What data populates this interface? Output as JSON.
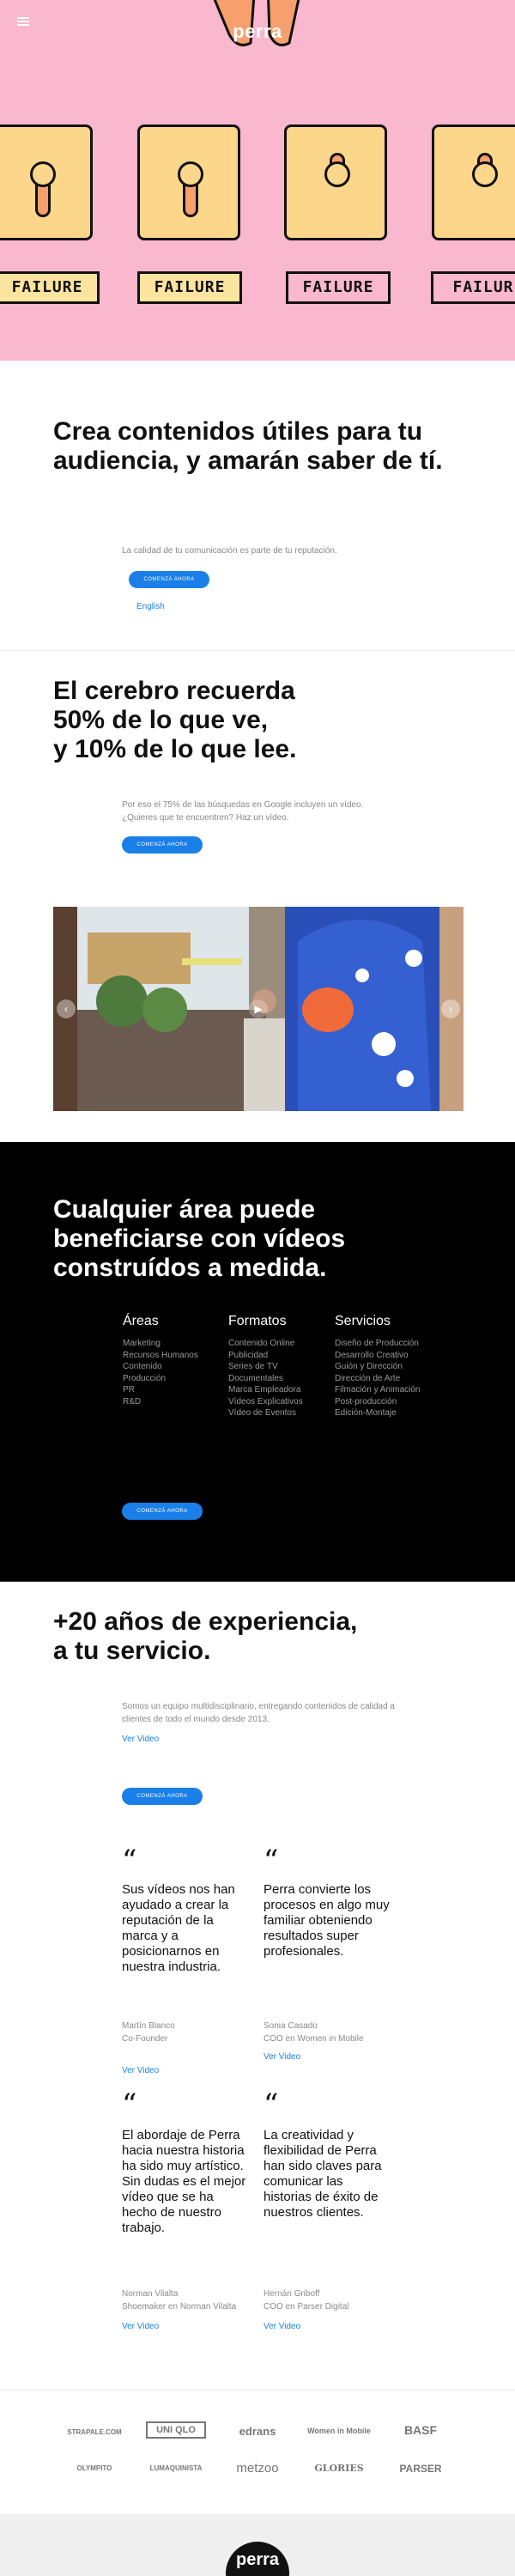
{
  "header": {
    "brand": "perra"
  },
  "hero": {
    "tags": [
      "FAILURE",
      "FAILURE",
      "FAILURE",
      "FAILUR"
    ]
  },
  "intro": {
    "title": "Crea contenidos útiles para tu audiencia, y amarán saber de tí.",
    "text": "La calidad de tu comunicación es parte de tu reputación.",
    "cta": "COMENZÁ AHORA",
    "lang_link": "English"
  },
  "brain": {
    "title_lines": [
      "El cerebro recuerda",
      "50% de lo que ve,",
      "y 10% de lo que lee."
    ],
    "text_lines": [
      "Por eso el 75% de las búsquedas en Google incluyen un vídeo.",
      "¿Quieres que te encuentren? Haz un vídeo."
    ],
    "cta": "COMENZÁ AHORA"
  },
  "video": {
    "prev": "‹",
    "next": "›",
    "play": "▶"
  },
  "areas": {
    "title_lines": [
      "Cualquier área puede",
      "beneficiarse con vídeos",
      "construídos a medida."
    ],
    "columns": [
      {
        "title": "Áreas",
        "items": [
          "Marketing",
          "Recursos Humanos",
          "Contenido",
          "Producción",
          "PR",
          "R&D"
        ]
      },
      {
        "title": "Formatos",
        "items": [
          "Contenido Online",
          "Publicidad",
          "Series de TV",
          "Documentales",
          "Marca Empleadora",
          "Vídeos Explicativos",
          "Vídeo de Eventos"
        ]
      },
      {
        "title": "Servicios",
        "items": [
          "Diseño de Producción",
          "Desarrollo Creativo",
          "Guión y Dirección",
          "Dirección de Arte",
          "Filmación y Animación",
          "Post-producción",
          "Edición-Montaje"
        ]
      }
    ],
    "cta": "COMENZÁ AHORA"
  },
  "experience": {
    "title_lines": [
      "+20 años de experiencia,",
      "a tu servicio."
    ],
    "text_lines": [
      "Somos un equipo multidisciplinario, entregando contenidos de calidad a",
      "clientes de todo el mundo desde 2013."
    ],
    "link": "Ver Video",
    "cta": "COMENZÁ AHORA"
  },
  "testimonials": [
    {
      "quote": "Sus vídeos nos han ayudado a crear la reputación de la marca y a posicionarnos en nuestra industria.",
      "name": "Martín Blanco",
      "role": "Co-Founder",
      "link": "Ver Video"
    },
    {
      "quote": "Perra convierte los procesos en algo muy familiar obteniendo resultados super profesionales.",
      "name": "Sonia Casado",
      "role": "COO en Women in Mobile",
      "link": "Ver Video"
    },
    {
      "quote": "El abordaje de Perra hacia nuestra historia ha sido muy artístico. Sin dudas es el mejor vídeo que se ha hecho de nuestro trabajo.",
      "name": "Norman Vilalta",
      "role": "Shoemaker en Norman Vilalta",
      "link": "Ver Video"
    },
    {
      "quote": "La creatividad y flexibilidad de Perra han sido claves para comunicar las historias de éxito de nuestros clientes.",
      "name": "Hernán Griboff",
      "role": "COO en Parser Digital",
      "link": "Ver Video"
    }
  ],
  "quote_mark": "“",
  "clients": [
    "STRAPALE.COM",
    "UNI QLO",
    "edrans",
    "Women in Mobile",
    "BASF",
    "OLYMPITO",
    "LUMAQUINISTA",
    "metzoo",
    "GLORIES",
    "PARSER"
  ],
  "footer": {
    "brand": "perra"
  }
}
